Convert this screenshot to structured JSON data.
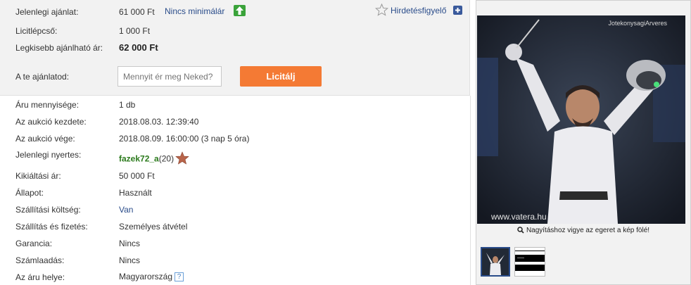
{
  "bid": {
    "current_offer_label": "Jelenlegi ajánlat:",
    "current_offer_value": "61 000 Ft",
    "no_minimum": "Nincs minimálár",
    "bid_step_label": "Licitlépcső:",
    "bid_step_value": "1 000 Ft",
    "min_bid_label": "Legkisebb ajánlható ár:",
    "min_bid_value": "62 000 Ft",
    "your_offer_label": "A te ajánlatod:",
    "input_placeholder": "Mennyit ér meg Neked?",
    "bid_button": "Licitálj",
    "watch_label": "Hirdetésfigyelő"
  },
  "details": [
    {
      "label": "Áru mennyisége:",
      "value": "1 db"
    },
    {
      "label": "Az aukció kezdete:",
      "value": "2018.08.03. 12:39:40"
    },
    {
      "label": "Az aukció vége:",
      "value": "2018.08.09. 16:00:00 (3 nap 5 óra)"
    },
    {
      "label": "Jelenlegi nyertes:",
      "value": "fazek72_a",
      "extra": "(20)"
    },
    {
      "label": "Kikiáltási ár:",
      "value": "50 000 Ft"
    },
    {
      "label": "Állapot:",
      "value": "Használt"
    },
    {
      "label": "Szállítási költség:",
      "value": "Van"
    },
    {
      "label": "Szállítás és fizetés:",
      "value": "Személyes átvétel"
    },
    {
      "label": "Garancia:",
      "value": "Nincs"
    },
    {
      "label": "Számlaadás:",
      "value": "Nincs"
    },
    {
      "label": "Az áru helye:",
      "value": "Magyarország",
      "help": "?"
    }
  ],
  "image": {
    "watermark_top": "JotekonysagiArveres",
    "watermark_bottom": "www.vatera.hu",
    "zoom_hint": "Nagyításhoz vigye az egeret a kép fölé!"
  },
  "colors": {
    "accent": "#f47a34",
    "link": "#2a4c8a",
    "winner": "#2b7a1c",
    "panel_bg": "#f2f2f2"
  },
  "icons": [
    "up-arrow-icon",
    "star-outline-icon",
    "plus-icon",
    "trophy-star-icon",
    "help-icon",
    "magnifier-icon"
  ]
}
